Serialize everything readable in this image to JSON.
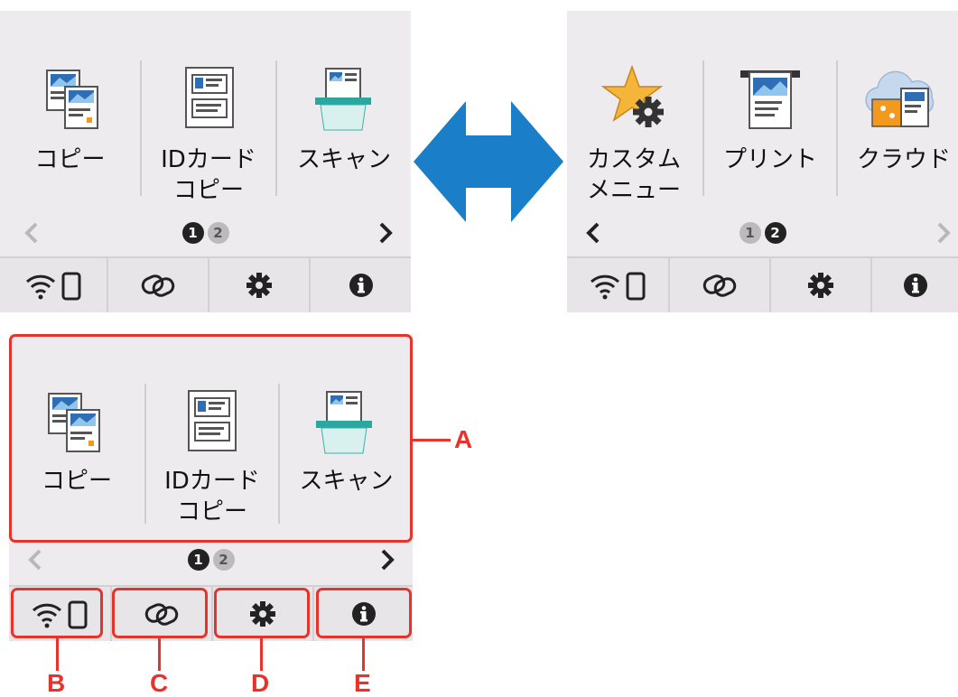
{
  "page1": {
    "tiles": [
      {
        "label": "コピー",
        "icon": "copy-icon"
      },
      {
        "label": "IDカード\nコピー",
        "icon": "id-card-copy-icon"
      },
      {
        "label": "スキャン",
        "icon": "scan-icon"
      }
    ],
    "dots": [
      {
        "label": "1",
        "active": true
      },
      {
        "label": "2",
        "active": false
      }
    ]
  },
  "page2": {
    "tiles": [
      {
        "label": "カスタム\nメニュー",
        "icon": "custom-menu-star-gear-icon"
      },
      {
        "label": "プリント",
        "icon": "print-icon"
      },
      {
        "label": "クラウド",
        "icon": "cloud-icon"
      }
    ],
    "dots": [
      {
        "label": "1",
        "active": false
      },
      {
        "label": "2",
        "active": true
      }
    ]
  },
  "bottom_bar": [
    {
      "name": "wireless-status",
      "icon": "wifi-smartphone-icon"
    },
    {
      "name": "wireless-connect",
      "icon": "link-icon"
    },
    {
      "name": "settings",
      "icon": "gear-icon"
    },
    {
      "name": "information",
      "icon": "info-icon"
    }
  ],
  "callouts": {
    "a": "A",
    "b": "B",
    "c": "C",
    "d": "D",
    "e": "E"
  },
  "colors": {
    "callout": "#e8332b",
    "arrow": "#1b7ec8",
    "screen_bg": "#edebee"
  }
}
